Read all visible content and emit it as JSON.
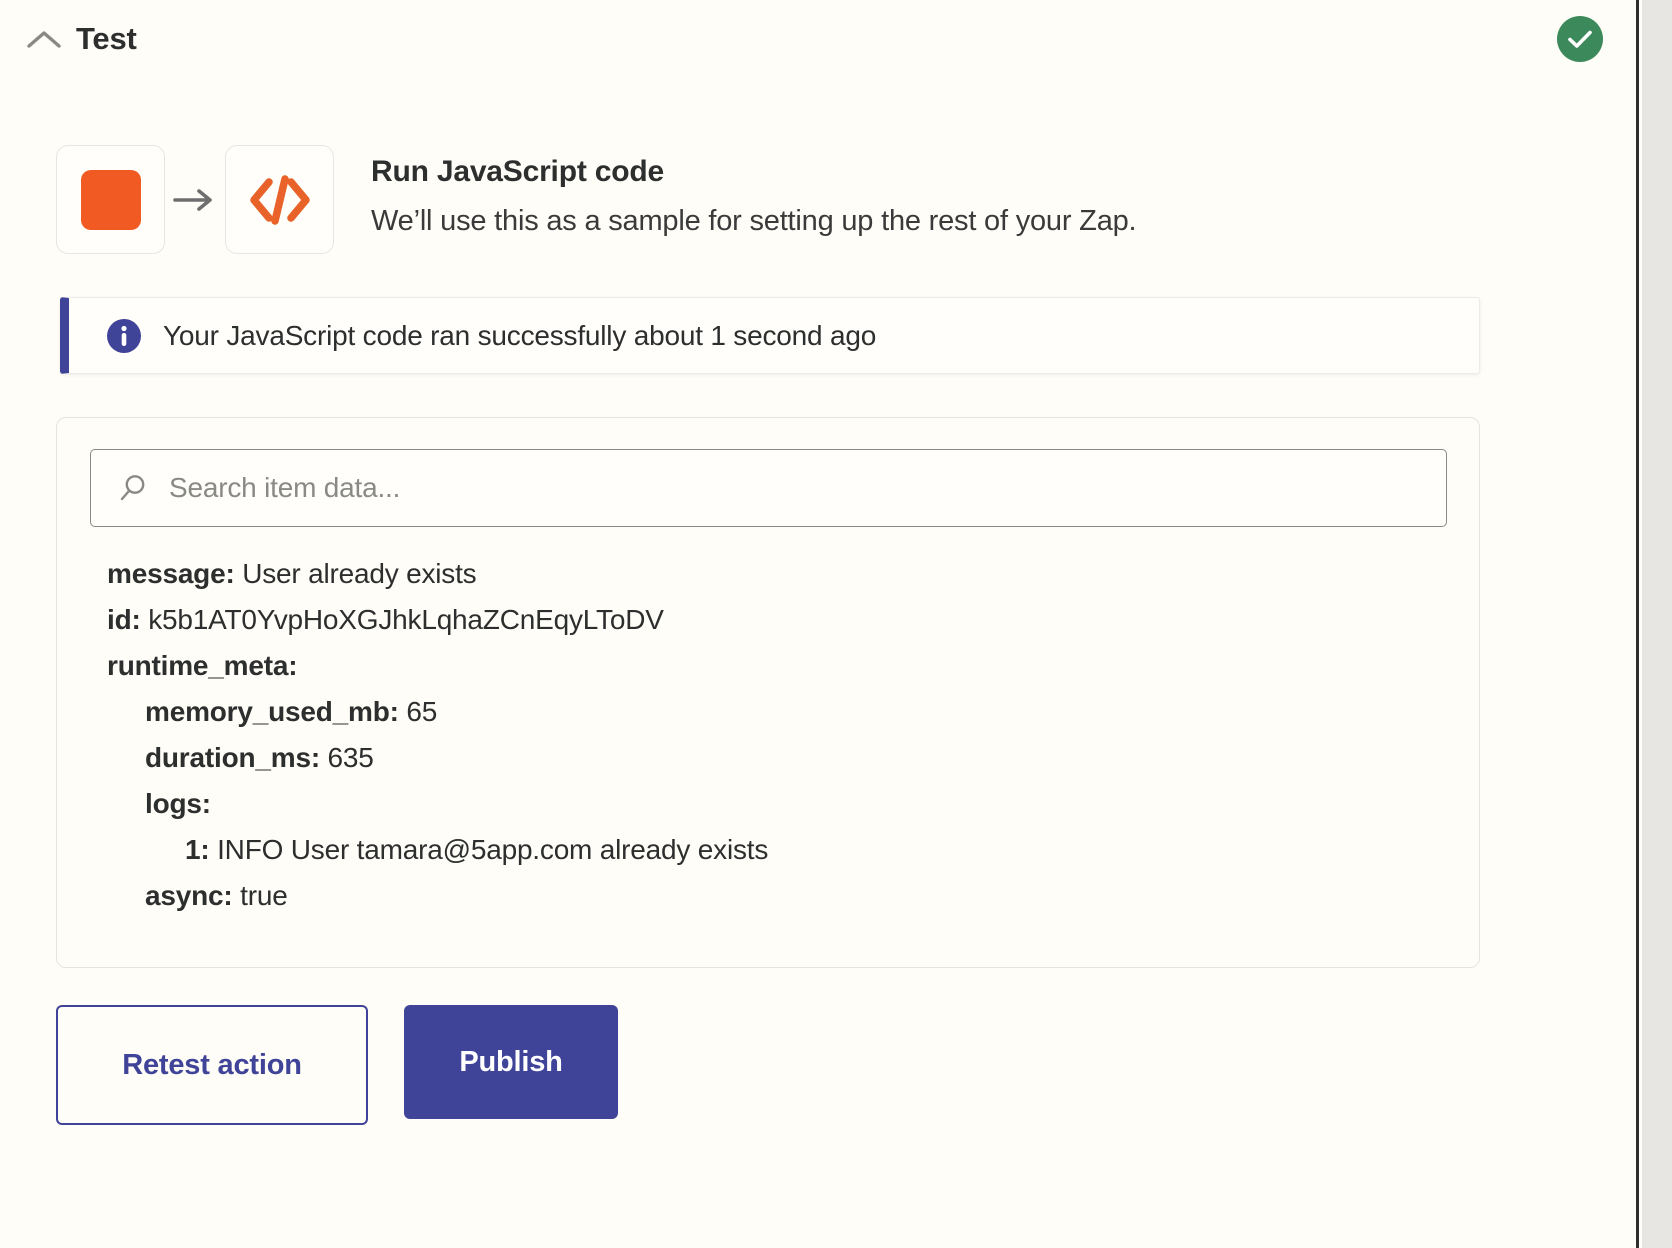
{
  "header": {
    "title": "Test",
    "collapse_icon": "chevron-up-icon",
    "status_icon": "check-icon",
    "status_color": "#3C8A5B"
  },
  "step": {
    "trigger_icon": "zapier-app-icon",
    "arrow_icon": "arrow-right-icon",
    "action_icon": "code-brackets-icon",
    "title": "Run JavaScript code",
    "subtitle": "We’ll use this as a sample for setting up the rest of your Zap.",
    "accent_color": "#F15A22"
  },
  "banner": {
    "icon": "info-icon",
    "message": "Your JavaScript code ran successfully about 1 second ago",
    "accent_color": "#3F4498"
  },
  "search": {
    "icon": "search-icon",
    "placeholder": "Search item data...",
    "value": ""
  },
  "item_data": [
    {
      "key": "message:",
      "value": "User already exists",
      "depth": 0
    },
    {
      "key": "id:",
      "value": "k5b1AT0YvpHoXGJhkLqhaZCnEqyLToDV",
      "depth": 0
    },
    {
      "key": "runtime_meta:",
      "value": "",
      "depth": 0
    },
    {
      "key": "memory_used_mb:",
      "value": "65",
      "depth": 1
    },
    {
      "key": "duration_ms:",
      "value": "635",
      "depth": 1
    },
    {
      "key": "logs:",
      "value": "",
      "depth": 1
    },
    {
      "key": "1:",
      "value": "INFO User tamara@5app.com already exists",
      "depth": 2
    },
    {
      "key": "async:",
      "value": "true",
      "depth": 1
    }
  ],
  "actions": {
    "retest_label": "Retest action",
    "publish_label": "Publish",
    "primary_color": "#3F4498"
  }
}
